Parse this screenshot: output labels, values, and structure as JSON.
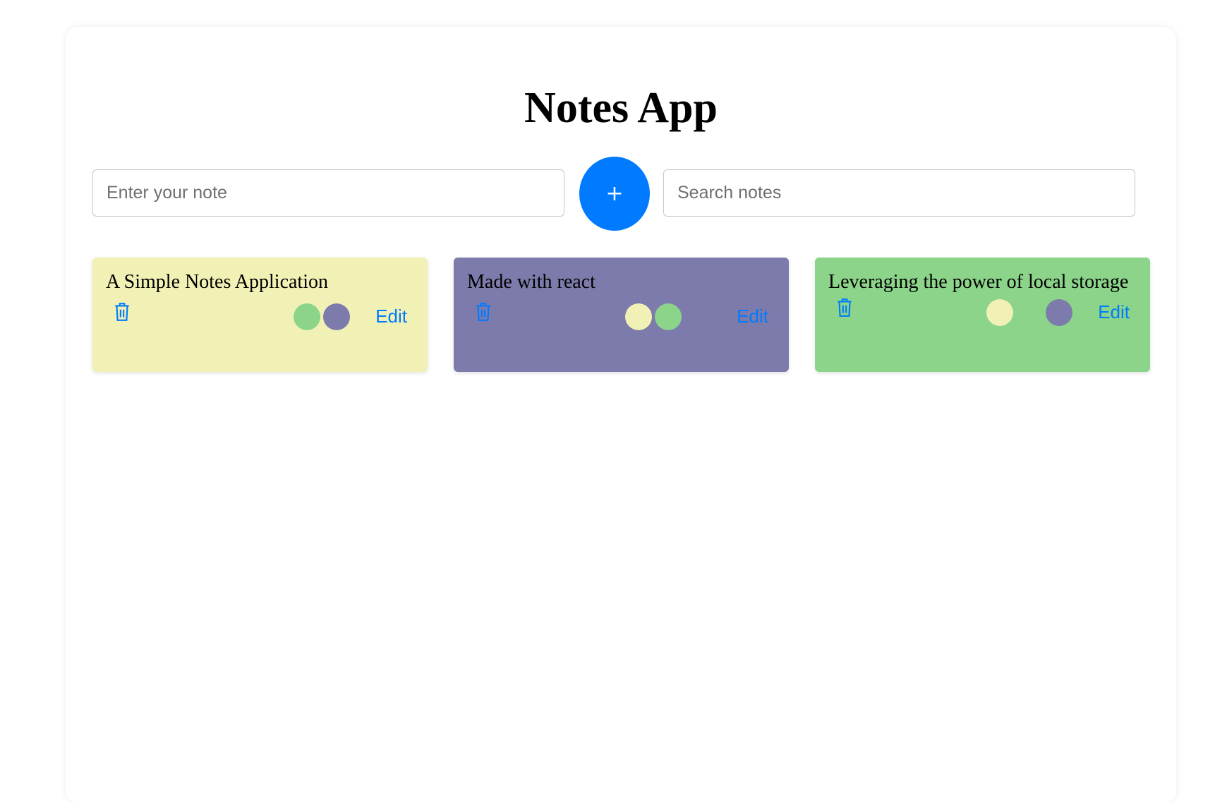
{
  "app": {
    "title": "Notes App"
  },
  "inputs": {
    "note_placeholder": "Enter your note",
    "search_placeholder": "Search notes",
    "add_label": "+"
  },
  "colors": {
    "yellow": "#f2f1b5",
    "purple": "#7d7bab",
    "green": "#8bd48a",
    "accent": "#007bff"
  },
  "notes": [
    {
      "text": "A Simple Notes Application",
      "color": "#f2f1b5",
      "swatches": [
        "#8bd48a",
        "#7d7bab"
      ],
      "edit_label": "Edit",
      "delete_icon": "trash-icon"
    },
    {
      "text": "Made with react",
      "color": "#7d7bab",
      "swatches": [
        "#f2f1b5",
        "#8bd48a"
      ],
      "edit_label": "Edit",
      "delete_icon": "trash-icon"
    },
    {
      "text": "Leveraging the power of local storage",
      "color": "#8bd48a",
      "swatches": [
        "#f2f1b5",
        "#7d7bab"
      ],
      "edit_label": "Edit",
      "delete_icon": "trash-icon"
    }
  ]
}
